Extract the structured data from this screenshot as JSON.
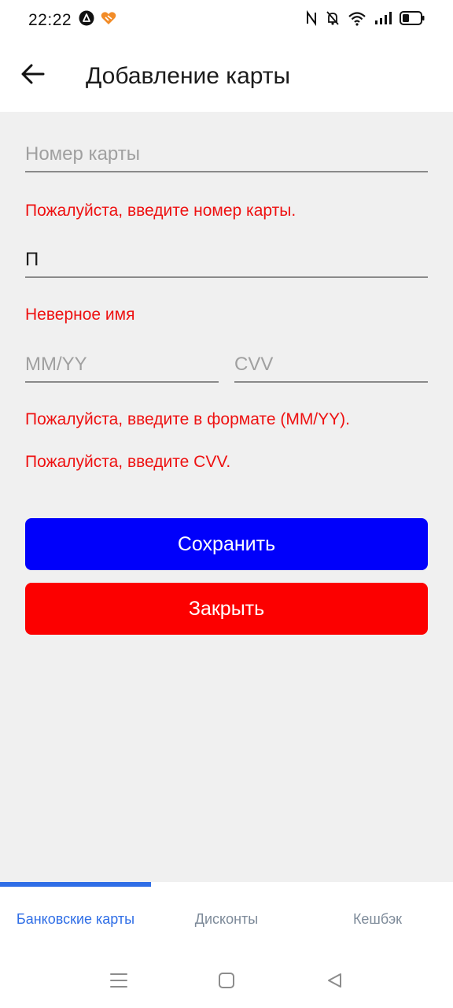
{
  "status_bar": {
    "time": "22:22",
    "left_icons": [
      "app-a-icon",
      "heart-app-icon"
    ],
    "right_icons": [
      "nfc-icon",
      "bell-off-icon",
      "wifi-icon",
      "signal-icon",
      "battery-icon"
    ]
  },
  "header": {
    "back_icon": "arrow-left-icon",
    "title": "Добавление карты"
  },
  "form": {
    "card_number": {
      "value": "",
      "placeholder": "Номер карты"
    },
    "card_number_error": "Пожалуйста, введите номер карты.",
    "name": {
      "value": "П",
      "placeholder": ""
    },
    "name_error": "Неверное имя",
    "expiry": {
      "value": "",
      "placeholder": "MM/YY"
    },
    "cvv": {
      "value": "",
      "placeholder": "CVV"
    },
    "expiry_error": "Пожалуйста, введите в формате (MM/YY).",
    "cvv_error": "Пожалуйста, введите CVV.",
    "save_label": "Сохранить",
    "close_label": "Закрыть"
  },
  "colors": {
    "save": "#0000fb",
    "close": "#fc0000",
    "error": "#ee1111",
    "accent": "#2f6ee6"
  },
  "tabs": [
    {
      "label": "Банковские карты",
      "active": true
    },
    {
      "label": "Дисконты",
      "active": false
    },
    {
      "label": "Кешбэк",
      "active": false
    }
  ],
  "system_nav": [
    "menu-icon",
    "home-icon",
    "back-triangle-icon"
  ]
}
